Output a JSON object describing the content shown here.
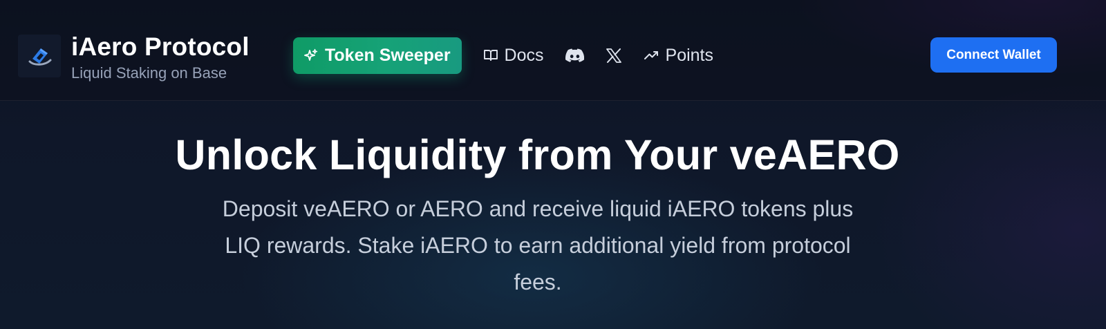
{
  "header": {
    "brand": {
      "title": "iAero Protocol",
      "subtitle": "Liquid Staking on Base",
      "logo_icon": "iaero-logo-icon"
    },
    "nav": {
      "token_sweeper": {
        "label": "Token Sweeper",
        "icon": "sparkles-icon",
        "color": "#10a16f"
      },
      "docs": {
        "label": "Docs",
        "icon": "book-icon"
      },
      "discord": {
        "icon": "discord-icon"
      },
      "x": {
        "icon": "x-icon"
      },
      "points": {
        "label": "Points",
        "icon": "trending-up-icon"
      }
    },
    "connect_wallet": {
      "label": "Connect Wallet",
      "color": "#1e6ff2"
    }
  },
  "hero": {
    "title": "Unlock Liquidity from Your veAERO",
    "description": "Deposit veAERO or AERO and receive liquid iAERO tokens plus LIQ rewards. Stake iAERO to earn additional yield from protocol fees."
  }
}
